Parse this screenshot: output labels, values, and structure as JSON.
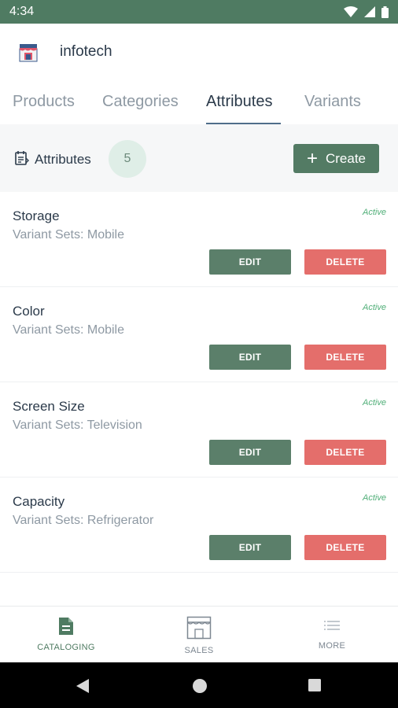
{
  "status_bar": {
    "time": "4:34"
  },
  "header": {
    "store_name": "infotech"
  },
  "tabs": [
    {
      "label": "Products",
      "active": false
    },
    {
      "label": "Categories",
      "active": false
    },
    {
      "label": "Attributes",
      "active": true
    },
    {
      "label": "Variants",
      "active": false
    }
  ],
  "toolbar": {
    "label": "Attributes",
    "count": "5",
    "create_label": "Create"
  },
  "attributes": [
    {
      "name": "Storage",
      "variant_sets": "Variant Sets: Mobile",
      "status": "Active",
      "edit_label": "EDIT",
      "delete_label": "DELETE"
    },
    {
      "name": "Color",
      "variant_sets": "Variant Sets: Mobile",
      "status": "Active",
      "edit_label": "EDIT",
      "delete_label": "DELETE"
    },
    {
      "name": "Screen Size",
      "variant_sets": "Variant Sets: Television",
      "status": "Active",
      "edit_label": "EDIT",
      "delete_label": "DELETE"
    },
    {
      "name": "Capacity",
      "variant_sets": "Variant Sets: Refrigerator",
      "status": "Active",
      "edit_label": "EDIT",
      "delete_label": "DELETE"
    }
  ],
  "bottom_nav": [
    {
      "label": "CATALOGING",
      "icon": "document-icon",
      "active": true
    },
    {
      "label": "SALES",
      "icon": "store-icon",
      "active": false
    },
    {
      "label": "MORE",
      "icon": "list-icon",
      "active": false
    }
  ],
  "colors": {
    "primary": "#537b64",
    "danger": "#e46e6b",
    "active_status": "#4fae77"
  }
}
